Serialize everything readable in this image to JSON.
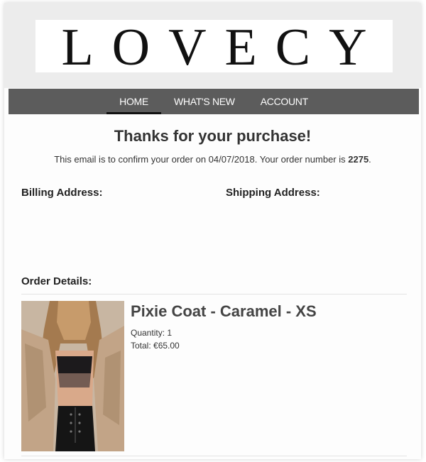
{
  "brand": {
    "logo_text": "LOVECY"
  },
  "nav": {
    "items": [
      {
        "label": "HOME",
        "active": true
      },
      {
        "label": "WHAT'S NEW",
        "active": false
      },
      {
        "label": "ACCOUNT",
        "active": false
      }
    ]
  },
  "email": {
    "heading": "Thanks for your purchase!",
    "confirm_prefix": "This email is to confirm your order on 04/07/2018. Your order number is ",
    "order_number": "2275",
    "confirm_suffix": "."
  },
  "addresses": {
    "billing_label": "Billing Address:",
    "shipping_label": "Shipping Address:"
  },
  "order": {
    "label": "Order Details:",
    "items": [
      {
        "name": "Pixie Coat - Caramel - XS",
        "quantity_text": "Quantity: 1",
        "total_text": "Total: €65.00",
        "image_alt": "product-photo"
      }
    ]
  },
  "colors": {
    "header_bg": "#ececec",
    "nav_bg": "#5c5c5c",
    "nav_text": "#ffffff",
    "active_underline": "#111111"
  }
}
